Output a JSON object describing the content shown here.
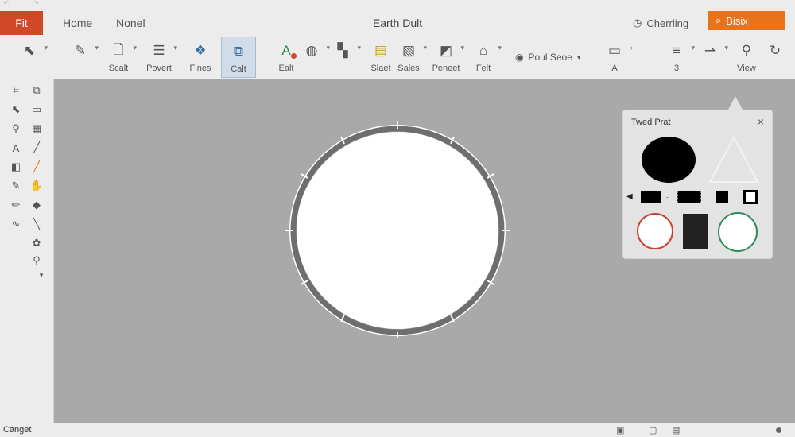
{
  "window": {
    "qat": [
      "↶",
      "↷"
    ],
    "file_tab": "Fit",
    "menu_tabs": [
      "Home",
      "Nonel"
    ],
    "title": "Earth Dult",
    "status_text": "Cherrling",
    "search_label": "Bisix"
  },
  "ribbon": {
    "buttons": [
      {
        "label": "",
        "icon": "lasso-select-icon"
      },
      {
        "label": "",
        "icon": "paint-brush-icon"
      },
      {
        "label": "Scalt",
        "icon": "page-icon"
      },
      {
        "label": "Povert",
        "icon": "format-lines-icon"
      },
      {
        "label": "Fines",
        "icon": "shapes-icon"
      },
      {
        "label": "Calt",
        "icon": "copy-icon",
        "active": true
      },
      {
        "label": "Ealt",
        "icon": "text-effect-icon"
      },
      {
        "label": "",
        "icon": "shape-fill-icon"
      },
      {
        "label": "",
        "icon": "arrange-icon"
      },
      {
        "label": "Slaet",
        "icon": "paste-icon"
      },
      {
        "label": "Sales",
        "icon": "clipboard-icon"
      },
      {
        "label": "Peneet",
        "icon": "comment-icon"
      },
      {
        "label": "Felt",
        "icon": "home-icon"
      }
    ],
    "font_picker": "Poul Seoe",
    "right_groups": [
      {
        "label": "A",
        "icon": "document-icon"
      },
      {
        "label": "3",
        "icon": "list-icon"
      },
      {
        "label": "",
        "icon": "draw-icon"
      },
      {
        "label": "View",
        "icon": "search-icon"
      }
    ]
  },
  "statusbar": {
    "left_text": "Canget"
  },
  "panel": {
    "title": "Twed Prat",
    "close": "×"
  },
  "colors": {
    "accent": "#e8731d",
    "file_tab": "#d24726",
    "canvas": "#a9a9a9",
    "red_outline": "#c9402a",
    "green_outline": "#2e8b57"
  }
}
